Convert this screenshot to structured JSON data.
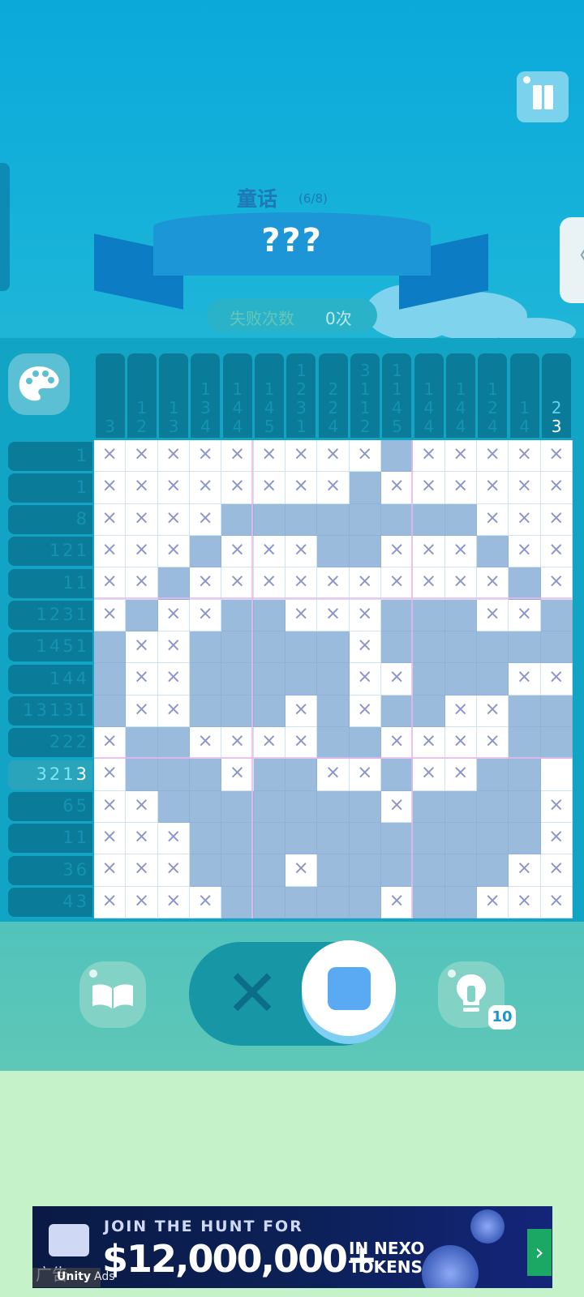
{
  "header": {
    "category": "童话",
    "progress": "(6/8)",
    "puzzle_name": "???",
    "fail_label": "失败次数",
    "fail_count": "0次"
  },
  "palette": {
    "icon": "palette-icon"
  },
  "column_clues": [
    [
      "3"
    ],
    [
      "1",
      "2"
    ],
    [
      "1",
      "3"
    ],
    [
      "1",
      "3",
      "4"
    ],
    [
      "1",
      "4",
      "4"
    ],
    [
      "1",
      "4",
      "5"
    ],
    [
      "1",
      "2",
      "3",
      "1"
    ],
    [
      "2",
      "2",
      "4"
    ],
    [
      "3",
      "1",
      "1",
      "2"
    ],
    [
      "1",
      "1",
      "4",
      "5"
    ],
    [
      "1",
      "4",
      "4"
    ],
    [
      "1",
      "4",
      "4"
    ],
    [
      "1",
      "2",
      "4"
    ],
    [
      "1",
      "4"
    ],
    [
      "2",
      "3"
    ]
  ],
  "row_clues": [
    "1",
    "1",
    "8",
    "121",
    "11",
    "1231",
    "1451",
    "144",
    "13131",
    "222",
    "3213",
    "65",
    "11",
    "36",
    "43"
  ],
  "selected": {
    "row": 10,
    "col": 14
  },
  "board": [
    "xxxxxxxxx.xxxxx",
    "xxxxxxxx.xxxxxx",
    "xxxx........xxx",
    "xxx.xxx..xxx.xx",
    "xx.xxxxxxxxxx.x",
    "x.xx..xxx...xx.",
    ".xx.....x......",
    ".xx.....xx...xx",
    ".xx...x.x..xx..",
    "x..xxxx..xxxx..",
    "x...x..xx.xx..-",
    "xx.......x....x",
    "xxx...........x",
    "xxx...x......xx",
    "xxxx.....x..xxx"
  ],
  "controls": {
    "book_icon": "book-icon",
    "mode_cross": "✕",
    "mode_fill_icon": "fill-square-icon",
    "hint_icon": "lightbulb-icon",
    "hint_count": "10"
  },
  "ad": {
    "line1": "JOIN THE HUNT FOR",
    "amount": "$12,000,000+",
    "tail1": "IN NEXO",
    "tail2": "TOKENS",
    "tag": "广告",
    "brand": "Unity",
    "brand_suffix": "Ads"
  }
}
